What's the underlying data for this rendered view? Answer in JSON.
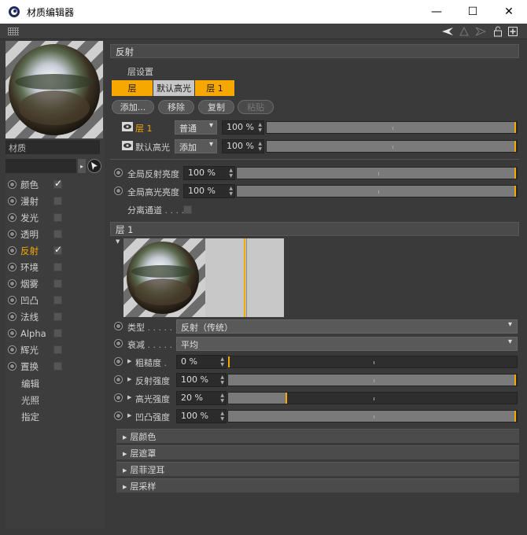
{
  "window": {
    "title": "材质编辑器",
    "minimize": "—",
    "maximize": "☐",
    "close": "✕"
  },
  "left": {
    "material_name": "材质",
    "channels": [
      {
        "label": "颜色",
        "checked": true,
        "active": false
      },
      {
        "label": "漫射",
        "checked": false,
        "active": false
      },
      {
        "label": "发光",
        "checked": false,
        "active": false
      },
      {
        "label": "透明",
        "checked": false,
        "active": false
      },
      {
        "label": "反射",
        "checked": true,
        "active": true
      },
      {
        "label": "环境",
        "checked": false,
        "active": false
      },
      {
        "label": "烟雾",
        "checked": false,
        "active": false
      },
      {
        "label": "凹凸",
        "checked": false,
        "active": false
      },
      {
        "label": "法线",
        "checked": false,
        "active": false
      },
      {
        "label": "Alpha",
        "checked": false,
        "active": false
      },
      {
        "label": "辉光",
        "checked": false,
        "active": false
      },
      {
        "label": "置换",
        "checked": false,
        "active": false
      }
    ],
    "extras": [
      "编辑",
      "光照",
      "指定"
    ]
  },
  "reflect": {
    "header": "反射",
    "layer_settings": "层设置",
    "tabs": [
      "层",
      "默认高光",
      "层 1"
    ],
    "buttons": {
      "add": "添加...",
      "remove": "移除",
      "copy": "复制",
      "paste": "粘贴"
    },
    "layers": [
      {
        "name": "层 1",
        "mode": "普通",
        "value": "100 %",
        "fraction": 1.0
      },
      {
        "name": "默认高光",
        "mode": "添加",
        "value": "100 %",
        "fraction": 1.0
      }
    ],
    "global_reflect": {
      "label": "全局反射亮度",
      "value": "100 %",
      "fraction": 1.0
    },
    "global_specular": {
      "label": "全局高光亮度",
      "value": "100 %",
      "fraction": 1.0
    },
    "separate": "分离通道"
  },
  "layer1": {
    "header": "层 1",
    "type": {
      "label": "类型",
      "value": "反射（传统）"
    },
    "attenuation": {
      "label": "衰减",
      "value": "平均"
    },
    "roughness": {
      "label": "粗糙度",
      "value": "0 %",
      "fraction": 0.0
    },
    "reflect_strength": {
      "label": "反射强度",
      "value": "100 %",
      "fraction": 1.0
    },
    "specular_strength": {
      "label": "高光强度",
      "value": "20 %",
      "fraction": 0.2
    },
    "bump_strength": {
      "label": "凹凸强度",
      "value": "100 %",
      "fraction": 1.0
    },
    "sections": [
      "层颜色",
      "层遮罩",
      "层菲涅耳",
      "层采样"
    ]
  },
  "colors": {
    "accent": "#f6a800"
  }
}
